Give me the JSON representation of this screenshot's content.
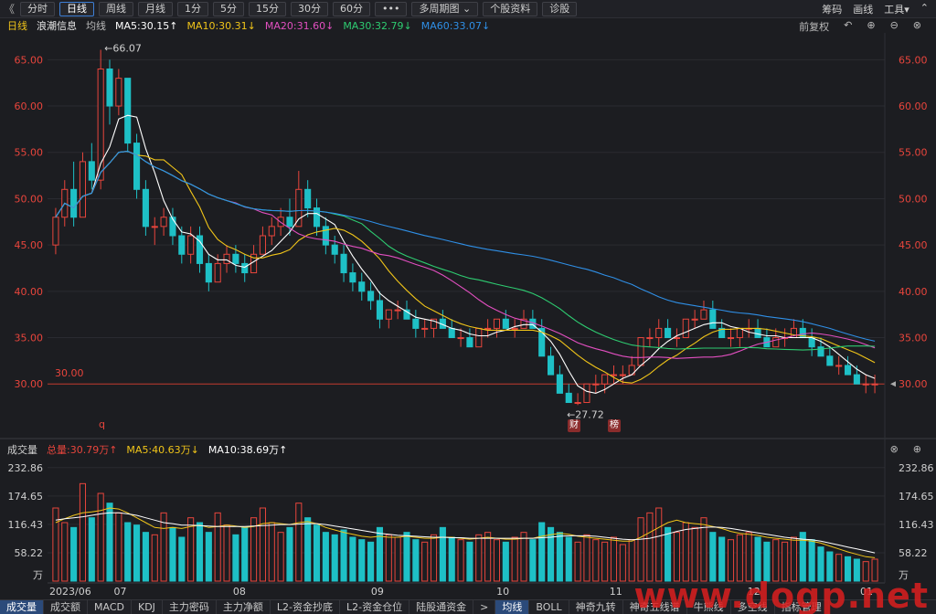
{
  "toolbar": {
    "back": "《",
    "buttons": [
      "分时",
      "日线",
      "周线",
      "月线",
      "1分",
      "5分",
      "15分",
      "30分",
      "60分",
      "•••",
      "多周期图",
      "个股资料",
      "诊股"
    ],
    "active_index": 1,
    "right": [
      "筹码",
      "画线",
      "工具▾"
    ]
  },
  "ma_bar": {
    "period": "日线",
    "stock": "浪潮信息",
    "avg": "均线",
    "ma5": "MA5:30.15↑",
    "ma10": "MA10:30.31↓",
    "ma20": "MA20:31.60↓",
    "ma30": "MA30:32.79↓",
    "ma60": "MA60:33.07↓",
    "adjust": "前复权"
  },
  "vol_bar": {
    "title": "成交量",
    "total": "总量:30.79万↑",
    "ma5": "MA5:40.63万↓",
    "ma10": "MA10:38.69万↑"
  },
  "colors": {
    "up": "#e8453c",
    "down": "#1ec0c6",
    "ma5": "#ffffff",
    "ma10": "#f0c419",
    "ma20": "#e24fc0",
    "ma30": "#2ecc71",
    "ma60": "#2f8fe6",
    "axis": "#e8453c"
  },
  "annotations": {
    "high": "←66.07",
    "low": "←27.72",
    "ref_price": "30.00",
    "q_mark": "q",
    "badge1": "财",
    "badge2": "榜"
  },
  "chart_data": {
    "type": "candlestick",
    "y_ticks": [
      "65.00",
      "60.00",
      "55.00",
      "50.00",
      "45.00",
      "40.00",
      "35.00",
      "30.00"
    ],
    "ylim": [
      24.5,
      67.5
    ],
    "vol_ticks": [
      "232.86",
      "174.65",
      "116.43",
      "58.22",
      "万"
    ],
    "vol_max": 240,
    "x_ticks": [
      "2023/06",
      "07",
      "08",
      "09",
      "10",
      "11",
      "12",
      "01"
    ],
    "high_price": 66.07,
    "low_price": 27.72,
    "candles": [
      [
        45,
        49,
        44,
        48
      ],
      [
        48,
        52,
        47,
        51
      ],
      [
        51,
        54,
        47,
        48
      ],
      [
        48,
        55,
        48,
        54
      ],
      [
        54,
        56,
        51,
        52
      ],
      [
        52,
        66.07,
        51,
        64
      ],
      [
        64,
        65,
        58,
        60
      ],
      [
        60,
        64,
        59,
        63
      ],
      [
        63,
        63,
        55,
        56
      ],
      [
        56,
        57,
        50,
        51
      ],
      [
        51,
        52,
        46,
        47
      ],
      [
        47,
        48,
        45,
        47
      ],
      [
        47,
        49,
        46,
        48
      ],
      [
        48,
        49,
        45,
        46
      ],
      [
        46,
        47,
        43,
        44
      ],
      [
        44,
        47,
        43,
        46
      ],
      [
        46,
        47,
        42,
        43
      ],
      [
        43,
        44,
        40,
        41
      ],
      [
        41,
        44,
        41,
        43
      ],
      [
        43,
        45,
        42,
        44
      ],
      [
        44,
        45,
        42,
        43
      ],
      [
        43,
        44,
        41,
        42
      ],
      [
        42,
        45,
        42,
        44
      ],
      [
        44,
        47,
        44,
        46
      ],
      [
        46,
        48,
        45,
        47
      ],
      [
        47,
        49,
        46,
        48
      ],
      [
        48,
        50,
        46,
        47
      ],
      [
        47,
        53,
        47,
        51
      ],
      [
        51,
        52,
        48,
        49
      ],
      [
        49,
        50,
        46,
        47
      ],
      [
        47,
        48,
        44,
        45
      ],
      [
        45,
        46,
        43,
        44
      ],
      [
        44,
        45,
        41,
        42
      ],
      [
        42,
        43,
        40,
        41
      ],
      [
        41,
        42,
        39,
        40
      ],
      [
        40,
        41,
        38,
        39
      ],
      [
        39,
        40,
        36,
        37
      ],
      [
        37,
        38,
        36,
        38
      ],
      [
        38,
        39,
        37,
        38
      ],
      [
        38,
        39,
        37,
        37
      ],
      [
        37,
        38,
        35,
        36
      ],
      [
        36,
        37,
        35,
        36
      ],
      [
        36,
        37,
        35,
        37
      ],
      [
        37,
        38,
        36,
        36
      ],
      [
        36,
        37,
        35,
        35
      ],
      [
        35,
        36,
        34,
        35
      ],
      [
        35,
        36,
        34,
        34
      ],
      [
        34,
        36,
        34,
        36
      ],
      [
        36,
        37,
        35,
        36
      ],
      [
        36,
        37,
        35,
        37
      ],
      [
        37,
        38,
        36,
        36
      ],
      [
        36,
        37,
        35,
        36
      ],
      [
        36,
        38,
        36,
        37
      ],
      [
        37,
        38,
        36,
        36
      ],
      [
        36,
        37,
        33,
        33
      ],
      [
        33,
        34,
        31,
        31
      ],
      [
        31,
        32,
        29,
        29
      ],
      [
        29,
        30,
        28,
        28
      ],
      [
        28,
        29,
        27.72,
        28
      ],
      [
        28,
        30,
        28,
        30
      ],
      [
        30,
        31,
        29,
        30
      ],
      [
        30,
        31,
        29,
        31
      ],
      [
        31,
        32,
        30,
        31
      ],
      [
        31,
        32,
        30,
        31
      ],
      [
        31,
        33,
        31,
        32
      ],
      [
        32,
        35,
        32,
        35
      ],
      [
        35,
        36,
        34,
        35
      ],
      [
        35,
        37,
        34,
        36
      ],
      [
        36,
        37,
        35,
        35
      ],
      [
        35,
        36,
        34,
        35
      ],
      [
        35,
        37,
        35,
        37
      ],
      [
        37,
        38,
        36,
        37
      ],
      [
        37,
        39,
        37,
        38
      ],
      [
        38,
        39,
        36,
        36
      ],
      [
        36,
        37,
        35,
        35
      ],
      [
        35,
        36,
        34,
        35
      ],
      [
        35,
        36,
        34,
        36
      ],
      [
        36,
        37,
        35,
        36
      ],
      [
        36,
        37,
        35,
        35
      ],
      [
        35,
        36,
        34,
        34
      ],
      [
        34,
        36,
        34,
        35
      ],
      [
        35,
        36,
        34,
        35
      ],
      [
        35,
        37,
        35,
        36
      ],
      [
        36,
        37,
        35,
        35
      ],
      [
        35,
        36,
        33,
        34
      ],
      [
        34,
        35,
        33,
        33
      ],
      [
        33,
        34,
        32,
        32
      ],
      [
        32,
        33,
        31,
        32
      ],
      [
        32,
        33,
        31,
        31
      ],
      [
        31,
        32,
        30,
        30
      ],
      [
        30,
        31,
        29,
        30
      ],
      [
        30,
        31,
        29,
        30
      ]
    ],
    "volumes": [
      150,
      120,
      110,
      200,
      130,
      180,
      160,
      140,
      120,
      115,
      100,
      95,
      140,
      110,
      90,
      130,
      120,
      100,
      140,
      115,
      95,
      110,
      130,
      150,
      120,
      100,
      110,
      160,
      130,
      115,
      100,
      95,
      105,
      90,
      85,
      80,
      110,
      95,
      90,
      100,
      85,
      80,
      95,
      110,
      90,
      85,
      80,
      95,
      100,
      85,
      80,
      90,
      100,
      85,
      120,
      110,
      100,
      90,
      80,
      95,
      85,
      80,
      90,
      75,
      85,
      130,
      140,
      150,
      110,
      100,
      120,
      110,
      130,
      100,
      90,
      85,
      95,
      100,
      90,
      80,
      85,
      80,
      90,
      100,
      85,
      70,
      60,
      55,
      50,
      45,
      40,
      45
    ],
    "ma5_vol": [
      120,
      128,
      135,
      140,
      142,
      145,
      150,
      148,
      140,
      130,
      120,
      110,
      108,
      110,
      108,
      112,
      115,
      110,
      112,
      115,
      113,
      110,
      112,
      118,
      120,
      118,
      116,
      120,
      122,
      118,
      110,
      105,
      100,
      96,
      92,
      90,
      92,
      90,
      90,
      92,
      90,
      88,
      88,
      90,
      90,
      88,
      86,
      88,
      90,
      88,
      86,
      86,
      88,
      88,
      92,
      95,
      98,
      96,
      92,
      90,
      88,
      86,
      84,
      82,
      82,
      90,
      100,
      110,
      120,
      125,
      120,
      118,
      116,
      112,
      108,
      102,
      98,
      96,
      94,
      90,
      88,
      86,
      84,
      84,
      82,
      78,
      72,
      66,
      60,
      55,
      50,
      48
    ],
    "ma10_vol": [
      125,
      128,
      130,
      132,
      135,
      138,
      140,
      140,
      138,
      135,
      130,
      125,
      120,
      118,
      115,
      115,
      114,
      113,
      112,
      112,
      112,
      112,
      113,
      114,
      115,
      116,
      116,
      117,
      118,
      118,
      116,
      113,
      110,
      107,
      104,
      101,
      98,
      96,
      94,
      93,
      92,
      91,
      90,
      90,
      89,
      89,
      88,
      88,
      88,
      88,
      88,
      88,
      88,
      88,
      89,
      90,
      92,
      93,
      93,
      93,
      92,
      90,
      88,
      86,
      85,
      86,
      88,
      92,
      97,
      102,
      106,
      108,
      110,
      111,
      110,
      108,
      105,
      102,
      99,
      96,
      93,
      90,
      88,
      86,
      85,
      82,
      78,
      74,
      70,
      66,
      62,
      58
    ]
  },
  "bottom_tabs": [
    "成交量",
    "成交额",
    "MACD",
    "KDJ",
    "主力密码",
    "主力净额",
    "L2-资金抄底",
    "L2-资金仓位",
    "陆股通资金"
  ],
  "bottom_tabs_right": [
    "均线",
    "BOLL",
    "神奇九转",
    "神奇五线谱",
    "牛熊线",
    "多空线",
    "指标管理"
  ],
  "watermark": "www.dogp.net"
}
